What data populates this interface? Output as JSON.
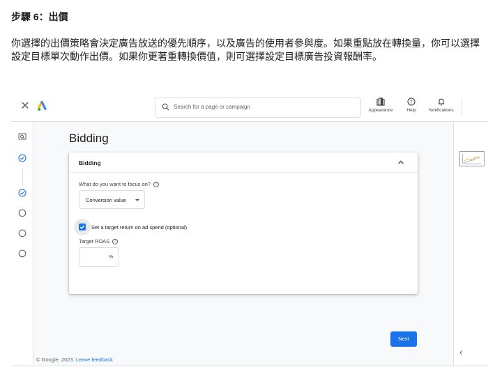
{
  "step": {
    "title": "步驟 6：出價",
    "description": "你選擇的出價策略會決定廣告放送的優先順序，以及廣告的使用者參與度。如果重點放在轉換量，你可以選擇設定目標單次動作出價。如果你更著重轉換價值，則可選擇設定目標廣告投資報酬率。"
  },
  "topbar": {
    "close_icon": "close-icon",
    "logo": "google-ads-logo",
    "search_placeholder": "Search for a page or campaign",
    "items": [
      {
        "label": "Appearance",
        "icon": "appearance-icon"
      },
      {
        "label": "Help",
        "icon": "help-icon"
      },
      {
        "label": "Notifications",
        "icon": "bell-icon"
      }
    ]
  },
  "main": {
    "page_title": "Bidding",
    "card": {
      "title": "Bidding",
      "focus_question": "What do you want to focus on?",
      "focus_value": "Conversion value",
      "target_checkbox_label": "Set a target return on ad spend (optional)",
      "target_checked": true,
      "roas_label": "Target ROAS",
      "roas_value": "",
      "roas_unit": "%"
    },
    "next_label": "Next"
  },
  "footer": {
    "copyright": "© Google, 2023.",
    "feedback_link": "Leave feedback"
  },
  "colors": {
    "accent": "#1a73e8",
    "logo_blue": "#4285f4",
    "logo_yellow": "#fbbc04",
    "logo_green": "#34a853"
  }
}
